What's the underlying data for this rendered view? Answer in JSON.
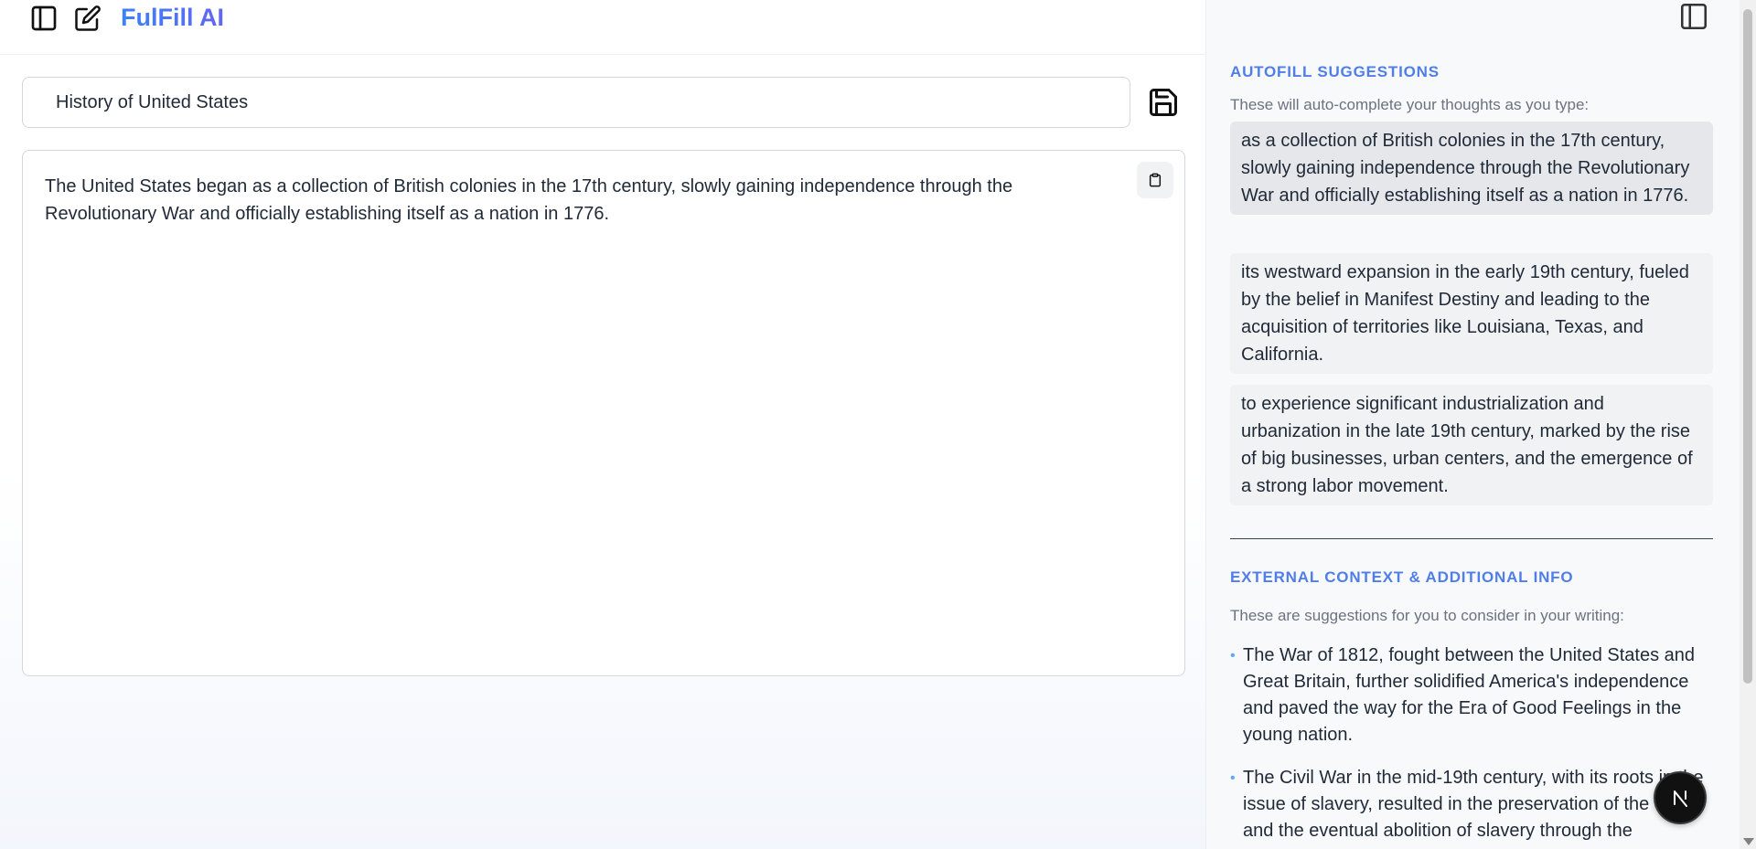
{
  "app": {
    "brand": "FulFill AI"
  },
  "editor": {
    "title_value": "History of United States",
    "body_text": "The United States began as a collection of British colonies in the 17th century, slowly gaining independence through the Revolutionary War and officially establishing itself as a nation in 1776."
  },
  "autofill": {
    "heading": "AUTOFILL SUGGESTIONS",
    "subtitle": "These will auto-complete your thoughts as you type:",
    "items": [
      "as a collection of British colonies in the 17th century, slowly gaining independence through the Revolutionary War and officially establishing itself as a nation in 1776.",
      "its westward expansion in the early 19th century, fueled by the belief in Manifest Destiny and leading to the acquisition of territories like Louisiana, Texas, and California.",
      "to experience significant industrialization and urbanization in the late 19th century, marked by the rise of big businesses, urban centers, and the emergence of a strong labor movement."
    ]
  },
  "external": {
    "heading": "EXTERNAL CONTEXT & ADDITIONAL INFO",
    "subtitle": "These are suggestions for you to consider in your writing:",
    "items": [
      "The War of 1812, fought between the United States and Great Britain, further solidified America's independence and paved the way for the Era of Good Feelings in the young nation.",
      "The Civil War in the mid-19th century, with its roots in the issue of slavery, resulted in the preservation of the Union and the eventual abolition of slavery through the"
    ]
  },
  "badge": {
    "letter": "N"
  },
  "icons": {
    "sidebar_toggle": "sidebar-toggle-icon",
    "new_document": "edit-icon",
    "save": "save-icon",
    "copy": "clipboard-icon",
    "panel_toggle": "panel-toggle-icon"
  },
  "colors": {
    "accent": "#4f7ee8",
    "brand_gradient_start": "#3b82f6",
    "brand_gradient_end": "#6366f1"
  }
}
